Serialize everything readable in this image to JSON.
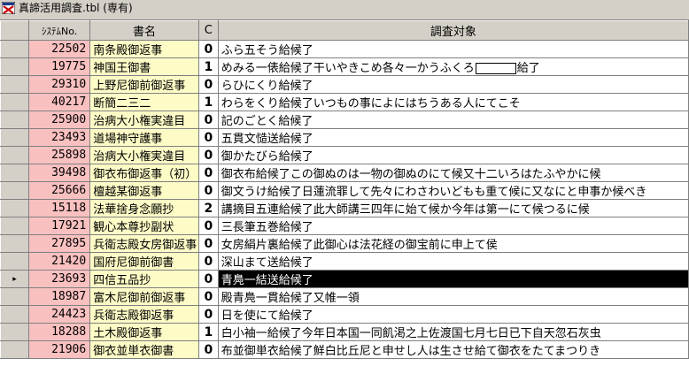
{
  "window": {
    "title": "真諦活用調査.tbl (専有)",
    "icon": "app-icon"
  },
  "columns": {
    "id": "ｼｽﾃﾑNo.",
    "name": "書名",
    "c": "C",
    "text": "調査対象"
  },
  "row_pointer_glyph": "▸",
  "rows": [
    {
      "id": "22502",
      "name": "南条殿御返事",
      "c": "0",
      "text_parts": [
        "ふら五そう給候了"
      ]
    },
    {
      "id": "19775",
      "name": "神国王御書",
      "c": "1",
      "text_parts": [
        "めみる一俵給候了干いやきこめ各々一かうふくろ",
        "給了"
      ]
    },
    {
      "id": "29310",
      "name": "上野尼御前御返事",
      "c": "0",
      "text_parts": [
        "らひにくり給候了"
      ]
    },
    {
      "id": "40217",
      "name": "断簡二三二",
      "c": "1",
      "text_parts": [
        "わらをくり給候了いつもの事によにはちうある人にてこそ"
      ]
    },
    {
      "id": "25900",
      "name": "治病大小権実違目",
      "c": "0",
      "text_parts": [
        "記のごとく給候了"
      ]
    },
    {
      "id": "23493",
      "name": "道場神守護事",
      "c": "0",
      "text_parts": [
        "五貫文慥送給候了"
      ]
    },
    {
      "id": "25898",
      "name": "治病大小権実違目",
      "c": "0",
      "text_parts": [
        "御かたびら給候了"
      ]
    },
    {
      "id": "39498",
      "name": "御衣布御返事（初）",
      "c": "0",
      "text_parts": [
        "御衣布給候了この御ぬのは一物の御ぬのにて候又十二いろはたふやかに候"
      ]
    },
    {
      "id": "25666",
      "name": "檀越某御返事",
      "c": "0",
      "text_parts": [
        "御文うけ給候了日蓮流罪して先々にわさわいどもも重て候に又なにと申事か候べき"
      ]
    },
    {
      "id": "15118",
      "name": "法華捨身念願抄",
      "c": "2",
      "text_parts": [
        "講摘目五連給候了此大師講三四年に始て候か今年は第一にて候つるに候"
      ]
    },
    {
      "id": "17921",
      "name": "観心本尊抄副状",
      "c": "0",
      "text_parts": [
        "三長筆五巻給候了"
      ]
    },
    {
      "id": "27895",
      "name": "兵衛志殿女房御返事",
      "c": "0",
      "text_parts": [
        "女房絹片裏給候了此御心は法花経の御宝前に申上て侯"
      ]
    },
    {
      "id": "21420",
      "name": "国府尼御前御書",
      "c": "0",
      "text_parts": [
        "深山まて送給候了"
      ]
    },
    {
      "id": "23693",
      "name": "四信五品抄",
      "c": "0",
      "text_parts": [
        "青鳧一結送給候了"
      ],
      "selected": true
    },
    {
      "id": "18987",
      "name": "富木尼御前御返事",
      "c": "0",
      "text_parts": [
        "殿青鳧一貫給候了又帷一領"
      ]
    },
    {
      "id": "24423",
      "name": "兵衛志殿御返事",
      "c": "0",
      "text_parts": [
        "日を使にて給候了"
      ]
    },
    {
      "id": "18288",
      "name": "土木殿御返事",
      "c": "1",
      "text_parts": [
        "白小袖一給候了今年日本国一同飢渇之上佐渡国七月七日已下自天忽石灰虫"
      ]
    },
    {
      "id": "21906",
      "name": "御衣並単衣御書",
      "c": "0",
      "text_parts": [
        "布並御単衣給候了鮮白比丘尼と申せし人は生させ給て御衣をたてまつりき"
      ]
    }
  ]
}
